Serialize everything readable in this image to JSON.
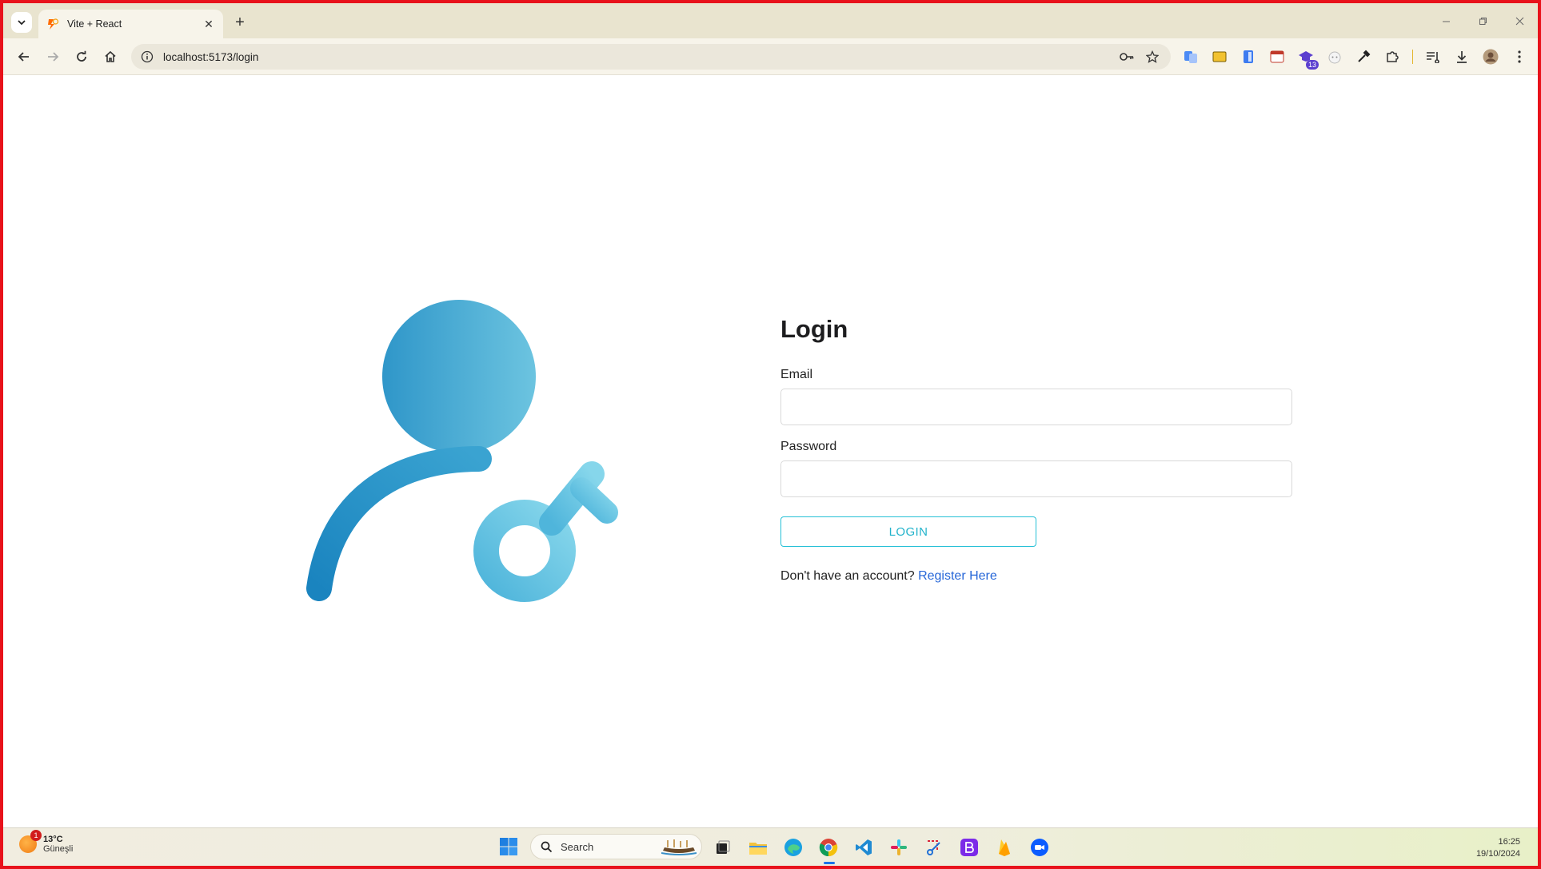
{
  "browser": {
    "tab_title": "Vite + React",
    "url": "localhost:5173/login",
    "new_tab": "+",
    "close_tab": "✕",
    "ext_badge": "13"
  },
  "login": {
    "title": "Login",
    "email_label": "Email",
    "email_value": "",
    "password_label": "Password",
    "password_value": "",
    "submit_label": "LOGIN",
    "register_prompt": "Don't have an account?",
    "register_link": "Register Here"
  },
  "taskbar": {
    "weather_temp": "13°C",
    "weather_condition": "Güneşli",
    "weather_badge": "1",
    "search_label": "Search",
    "time": "16:25",
    "date": "19/10/2024"
  },
  "colors": {
    "border": "#e8121b",
    "accent": "#25c0d6",
    "link": "#2767d8",
    "illustration_dark": "#1f88c1",
    "illustration_light": "#7dd3e6"
  }
}
